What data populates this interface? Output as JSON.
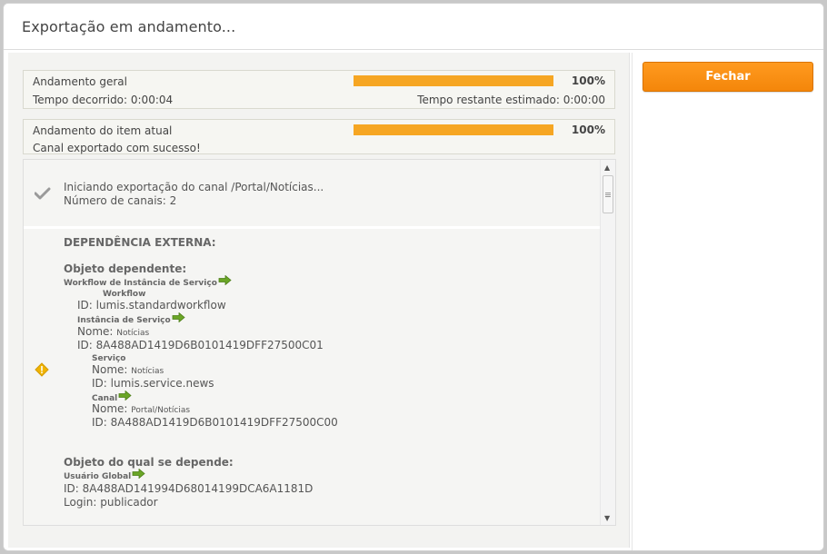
{
  "dialog": {
    "title": "Exportação em andamento..."
  },
  "actions": {
    "close_label": "Fechar"
  },
  "overall": {
    "label": "Andamento geral",
    "percent_text": "100%",
    "progress": 1.0,
    "elapsed": "Tempo decorrido: 0:00:04",
    "remaining": "Tempo restante estimado: 0:00:00"
  },
  "current_item": {
    "label": "Andamento do item atual",
    "percent_text": "100%",
    "progress": 1.0,
    "status": "Canal exportado com sucesso!"
  },
  "log": {
    "entry1": {
      "icon": "check-icon",
      "line1": "Iniciando exportação do canal /Portal/Notícias...",
      "line2": "Número de canais: 2"
    },
    "entry2": {
      "icon": "warning-icon",
      "heading": "DEPENDÊNCIA EXTERNA:",
      "dependent_heading": "Objeto dependente:",
      "workflow_instance_label": "Workflow de Instância de Serviço",
      "workflow_label": "Workflow",
      "workflow_id": "ID: lumis.standardworkflow",
      "service_instance_label": "Instância de Serviço",
      "si_name_key": "Nome:",
      "si_name_value": "Notícias",
      "si_id": "ID: 8A488AD1419D6B0101419DFF27500C01",
      "service_label": "Serviço",
      "svc_name_key": "Nome:",
      "svc_name_value": "Notícias",
      "svc_id": "ID: lumis.service.news",
      "channel_label": "Canal",
      "ch_name_key": "Nome:",
      "ch_name_value": "Portal/Notícias",
      "ch_id": "ID: 8A488AD1419D6B0101419DFF27500C00",
      "depends_on_heading": "Objeto do qual se depende:",
      "global_user_label": "Usuário Global",
      "gu_id": "ID: 8A488AD141994D68014199DCA6A1181D",
      "gu_login": "Login: publicador"
    }
  },
  "colors": {
    "accent": "#f4860a",
    "progress": "#f6a623",
    "link_arrow": "#6aa526",
    "warning": "#f0b400"
  }
}
